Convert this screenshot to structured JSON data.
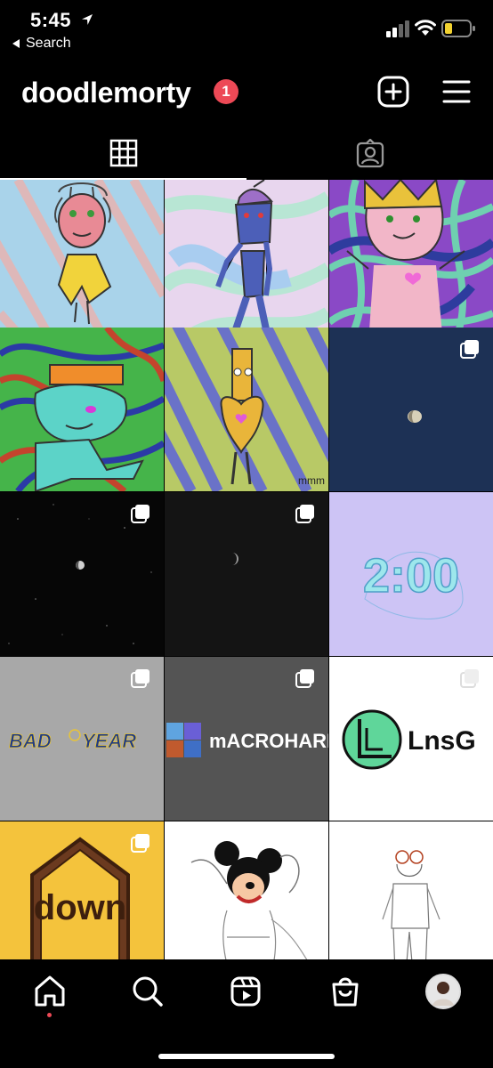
{
  "status_bar": {
    "time": "5:45",
    "back_label": "Search",
    "battery_color": "#f2d230"
  },
  "profile": {
    "username": "doodlemorty",
    "notification_count": "1",
    "badge_color": "#ed4956"
  },
  "tabs": [
    {
      "name": "posts-grid",
      "icon": "grid-icon",
      "active": true
    },
    {
      "name": "tagged",
      "icon": "tagged-person-icon",
      "active": false
    }
  ],
  "posts": [
    {
      "description": "doodle character with gray hair and yellow shirt",
      "multi": false
    },
    {
      "description": "blue doodle character with purple hat",
      "multi": false
    },
    {
      "description": "doodle character with crown and heart",
      "multi": false
    },
    {
      "description": "green alien doodle with orange hat",
      "multi": false
    },
    {
      "description": "yellow doodle character with heart",
      "multi": false
    },
    {
      "description": "moon in dark blue sky",
      "multi": true
    },
    {
      "description": "moon in starry night",
      "multi": true
    },
    {
      "description": "crescent moon in dark sky",
      "multi": true
    },
    {
      "description": "2:00 stylized text art",
      "multi": false
    },
    {
      "description": "bad year logo parody",
      "multi": true
    },
    {
      "description": "macrohard logo parody",
      "multi": true
    },
    {
      "description": "lnsg logo",
      "multi": true
    },
    {
      "description": "down logo parody",
      "multi": true
    },
    {
      "description": "mickey mouse drawing",
      "multi": false
    },
    {
      "description": "arthur character sketch",
      "multi": false
    }
  ],
  "post_texts": {
    "badyear_left": "BAD",
    "badyear_mid": "YEAR",
    "macrohard": "mACROHARD",
    "lnsg": "LnsG",
    "down": "down",
    "two_oclock": "2:00",
    "mmm": "mmm"
  },
  "bottom_nav": [
    {
      "name": "home",
      "icon": "home-icon",
      "active": true
    },
    {
      "name": "search",
      "icon": "search-icon",
      "active": false
    },
    {
      "name": "reels",
      "icon": "reels-icon",
      "active": false
    },
    {
      "name": "shop",
      "icon": "shopping-bag-icon",
      "active": false
    },
    {
      "name": "profile",
      "icon": "avatar",
      "active": false
    }
  ]
}
